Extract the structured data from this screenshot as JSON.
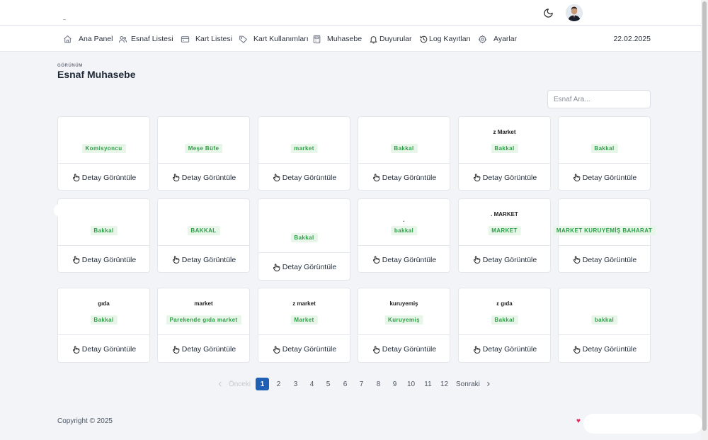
{
  "nav": {
    "items": [
      {
        "label": "Ana Panel",
        "icon": "home-icon"
      },
      {
        "label": "Esnaf Listesi",
        "icon": "users-icon"
      },
      {
        "label": "Kart Listesi",
        "icon": "credit-card-icon"
      },
      {
        "label": "Kart Kullanımları",
        "icon": "tag-icon"
      },
      {
        "label": "Muhasebe",
        "icon": "calculator-icon"
      },
      {
        "label": "Duyurular",
        "icon": "bell-icon"
      },
      {
        "label": "Log Kayıtları",
        "icon": "history-icon"
      },
      {
        "label": "Ayarlar",
        "icon": "gear-icon"
      }
    ],
    "date": "22.02.2025"
  },
  "page": {
    "pretitle": "GÖRÜNÜM",
    "title": "Esnaf Muhasebe",
    "search_placeholder": "Esnaf Ara..."
  },
  "cards": [
    {
      "name": "",
      "badge": "Komisyoncu",
      "button": "Detay Görüntüle"
    },
    {
      "name": "",
      "badge": "Meşe Büfe",
      "button": "Detay Görüntüle"
    },
    {
      "name": "",
      "badge": "market",
      "button": "Detay Görüntüle"
    },
    {
      "name": "",
      "badge": "Bakkal",
      "button": "Detay Görüntüle"
    },
    {
      "name": "z Market",
      "badge": "Bakkal",
      "button": "Detay Görüntüle"
    },
    {
      "name": "",
      "badge": "Bakkal",
      "button": "Detay Görüntüle"
    },
    {
      "name": "",
      "badge": "Bakkal",
      "button": "Detay Görüntüle"
    },
    {
      "name": "",
      "badge": "BAKKAL",
      "button": "Detay Görüntüle"
    },
    {
      "name": "",
      "badge": "Bakkal",
      "button": "Detay Görüntüle"
    },
    {
      "name": ".",
      "badge": "bakkal",
      "button": "Detay Görüntüle"
    },
    {
      "name": ". MARKET",
      "badge": "MARKET",
      "button": "Detay Görüntüle"
    },
    {
      "name": "",
      "badge": "MARKET KURUYEMİŞ BAHARAT",
      "button": "Detay Görüntüle"
    },
    {
      "name": "gıda",
      "badge": "Bakkal",
      "button": "Detay Görüntüle"
    },
    {
      "name": "market",
      "badge": "Parekende gıda market",
      "button": "Detay Görüntüle"
    },
    {
      "name": "z market",
      "badge": "Market",
      "button": "Detay Görüntüle"
    },
    {
      "name": "kuruyemiş",
      "badge": "Kuruyemiş",
      "button": "Detay Görüntüle"
    },
    {
      "name": "ε gıda",
      "badge": "Bakkal",
      "button": "Detay Görüntüle"
    },
    {
      "name": "",
      "badge": "bakkal",
      "button": "Detay Görüntüle"
    }
  ],
  "pagination": {
    "prev": "Önceki",
    "next": "Sonraki",
    "pages": [
      "1",
      "2",
      "3",
      "4",
      "5",
      "6",
      "7",
      "8",
      "9",
      "10",
      "11",
      "12"
    ],
    "active": "1"
  },
  "footer": {
    "copyright": "Copyright © 2025",
    "heart": "♥"
  },
  "colors": {
    "accent": "#1f5fb4",
    "badge_bg": "#e7f6e9",
    "badge_text": "#2e9e47",
    "heart": "#e8245c"
  }
}
